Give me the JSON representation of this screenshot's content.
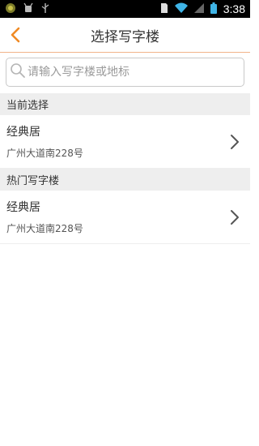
{
  "status_bar": {
    "time": "3:38",
    "icons": [
      "app-icon",
      "android-debug-icon",
      "usb-icon",
      "sim-icon",
      "wifi-icon",
      "signal-icon",
      "battery-icon"
    ]
  },
  "header": {
    "title": "选择写字楼",
    "back_icon": "chevron-left-icon"
  },
  "search": {
    "placeholder": "请输入写字楼或地标",
    "value": ""
  },
  "sections": [
    {
      "title": "当前选择",
      "items": [
        {
          "name": "经典居",
          "address": "广州大道南228号"
        }
      ]
    },
    {
      "title": "热门写字楼",
      "items": [
        {
          "name": "经典居",
          "address": "广州大道南228号"
        }
      ]
    }
  ],
  "colors": {
    "accent": "#f08a24",
    "header_divider": "#f2b38a",
    "section_bg": "#eeeeee"
  }
}
